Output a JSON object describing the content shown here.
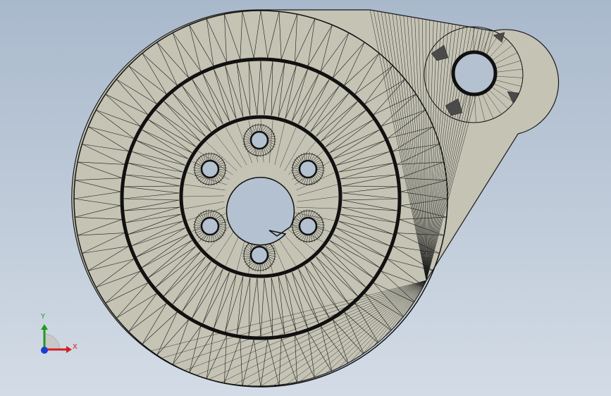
{
  "viewport": {
    "background_top": "#a9b9cc",
    "background_bottom": "#d3dce6"
  },
  "model": {
    "face_color": "#c4c3b4",
    "mesh_line_color": "#1a1a1a",
    "hole_color": "#b4c1d0",
    "bolt_hole_count": 6,
    "rendering": "wireframe-triangle-mesh"
  },
  "triad": {
    "x_label": "X",
    "y_label": "Y",
    "x_color": "#d42020",
    "y_color": "#1f9a1f",
    "z_color": "#1e3ccf"
  }
}
